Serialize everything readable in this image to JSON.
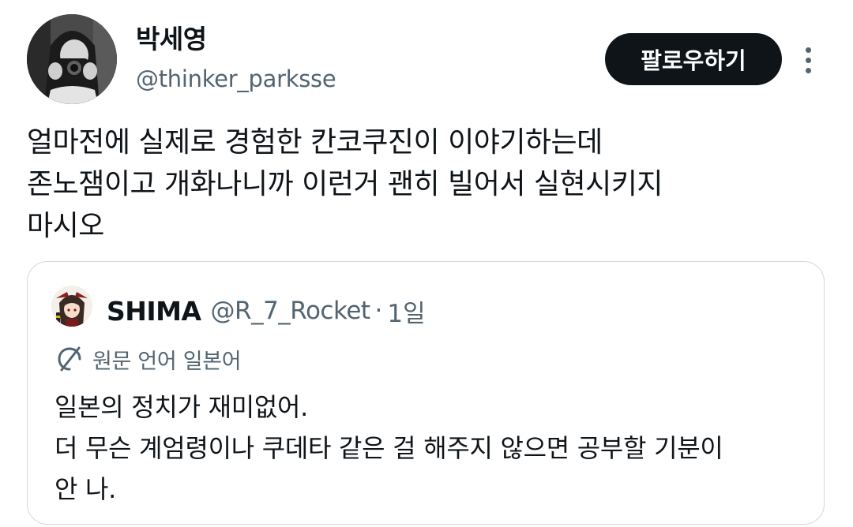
{
  "author": {
    "display_name": "박세영",
    "handle": "@thinker_parksse",
    "avatar_icon": "profile-photo-with-camera"
  },
  "actions": {
    "follow_label": "팔로우하기",
    "more_icon": "vertical-ellipsis-icon"
  },
  "tweet": {
    "lines": [
      "얼마전에 실제로 경험한 칸코쿠진이 이야기하는데",
      "존노잼이고 개화나니까 이런거 괜히 빌어서 실현시키지",
      "마시오"
    ]
  },
  "quote": {
    "display_name": "SHIMA",
    "handle": "@R_7_Rocket",
    "separator": "·",
    "time": "1일",
    "translate_label": "원문 언어 일본어",
    "translate_icon": "translate-slash-icon",
    "lines": [
      "일본의 정치가 재미없어.",
      "더 무슨 계엄령이나 쿠데타 같은 걸 해주지 않으면 공부할 기분이",
      "안 나."
    ]
  },
  "colors": {
    "text": "#0f1419",
    "secondary": "#536471",
    "border": "#cfd9de",
    "button_bg": "#0f1419",
    "button_text": "#ffffff"
  }
}
